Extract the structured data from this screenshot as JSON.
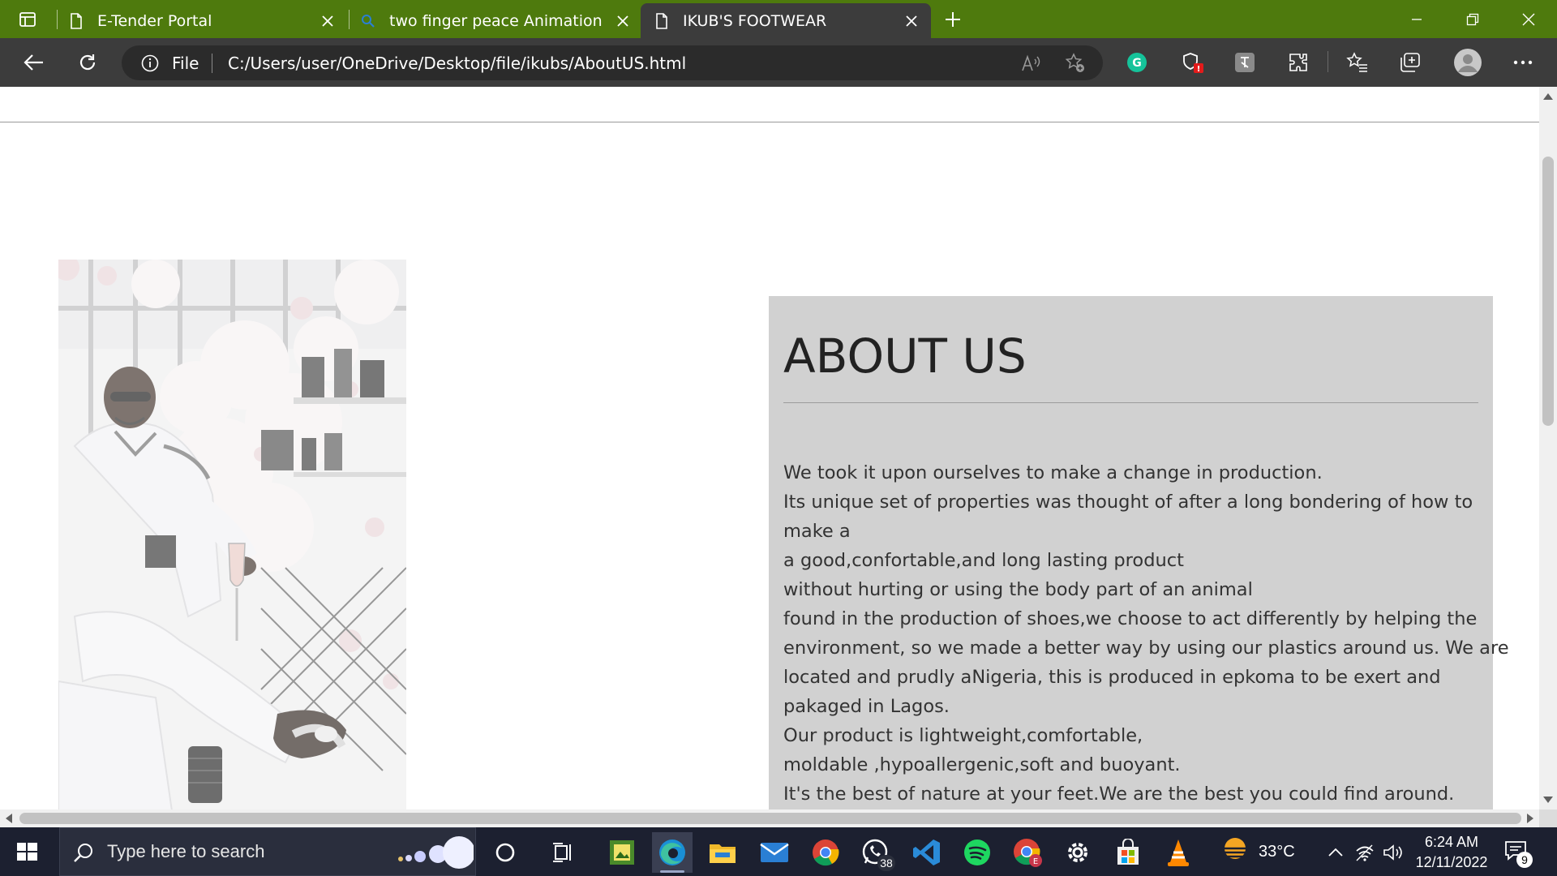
{
  "browser": {
    "tabs": [
      {
        "label": "E-Tender Portal",
        "icon": "page-icon",
        "active": false
      },
      {
        "label": "two finger peace Animation - Bin",
        "icon": "search-icon",
        "active": false
      },
      {
        "label": "IKUB'S FOOTWEAR",
        "icon": "page-icon",
        "active": true
      }
    ],
    "address": {
      "scheme": "File",
      "url": "C:/Users/user/OneDrive/Desktop/file/ikubs/AboutUS.html"
    },
    "accent_color": "#4e7a0d",
    "toolbar_color": "#3c3c3c"
  },
  "page": {
    "about": {
      "title": "ABOUT US",
      "lines": [
        "We took it upon ourselves to make a change in production.",
        "Its unique set of properties was thought of after a long bondering of how to",
        "make a",
        "a good,confortable,and long lasting product",
        "without hurting or using the body part of an animal",
        "found in the production of shoes,we choose to act differently by helping the",
        "environment, so we made a better way by using our plastics around us. We are",
        "located and prudly aNigeria, this is produced in epkoma to be exert and",
        "pakaged in Lagos.",
        "Our product is lightweight,comfortable,",
        "moldable ,hypoallergenic,soft and buoyant.",
        "It's the best of nature at your feet.We are the best you could find around."
      ],
      "panel_color": "#d1d1d1"
    }
  },
  "taskbar": {
    "search_placeholder": "Type here to search",
    "whatsapp_badge": "38",
    "weather_temp": "33°C",
    "time": "6:24 AM",
    "date": "12/11/2022",
    "notification_count": "9"
  }
}
